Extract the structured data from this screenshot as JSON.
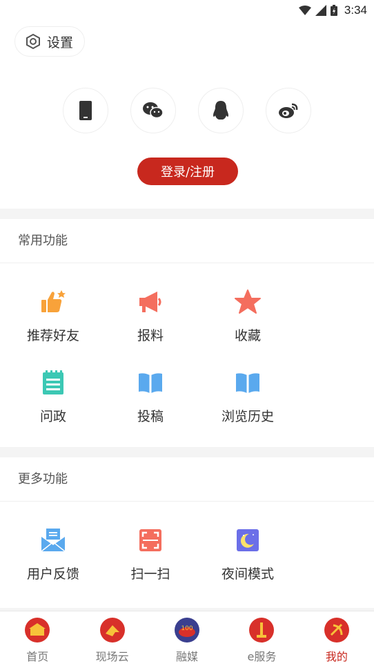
{
  "status": {
    "time": "3:34"
  },
  "header": {
    "settings_label": "设置",
    "login_label": "登录/注册"
  },
  "login_methods": [
    "phone-icon",
    "wechat-icon",
    "qq-icon",
    "weibo-icon"
  ],
  "common": {
    "title": "常用功能",
    "items": [
      {
        "label": "推荐好友",
        "icon": "thumbs-up-icon"
      },
      {
        "label": "报料",
        "icon": "megaphone-icon"
      },
      {
        "label": "收藏",
        "icon": "star-icon"
      },
      {
        "label": "问政",
        "icon": "notepad-icon"
      },
      {
        "label": "投稿",
        "icon": "book-icon"
      },
      {
        "label": "浏览历史",
        "icon": "book-icon"
      }
    ]
  },
  "more": {
    "title": "更多功能",
    "items": [
      {
        "label": "用户反馈",
        "icon": "mail-icon"
      },
      {
        "label": "扫一扫",
        "icon": "scan-icon"
      },
      {
        "label": "夜间模式",
        "icon": "moon-icon"
      }
    ]
  },
  "tabs": [
    {
      "label": "首页",
      "active": false
    },
    {
      "label": "现场云",
      "active": false
    },
    {
      "label": "融媒",
      "active": false
    },
    {
      "label": "e服务",
      "active": false
    },
    {
      "label": "我的",
      "active": true
    }
  ],
  "colors": {
    "accent": "#c8281e",
    "orange": "#f8a23a",
    "coral": "#f46e5e",
    "teal": "#3cc8b4",
    "blue": "#5aa9ee",
    "purple": "#6b6fe8"
  }
}
